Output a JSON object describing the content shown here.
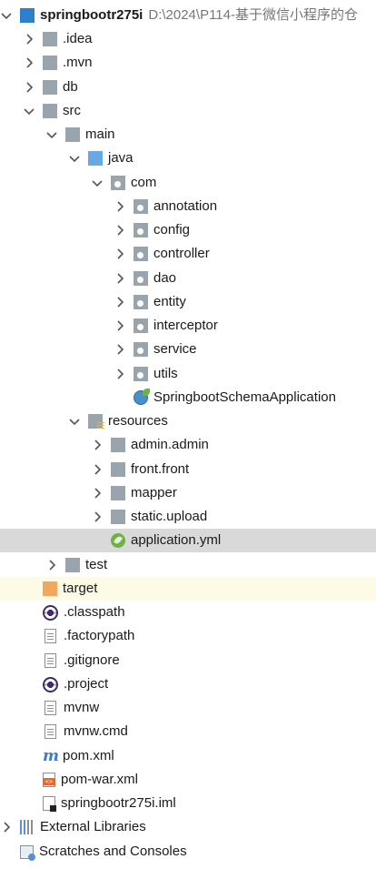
{
  "project": {
    "name": "springbootr275i",
    "path": "D:\\2024\\P114-基于微信小程序的仓"
  },
  "tree": {
    "idea": ".idea",
    "mvn": ".mvn",
    "db": "db",
    "src": "src",
    "main": "main",
    "java": "java",
    "com": "com",
    "annotation": "annotation",
    "config": "config",
    "controller": "controller",
    "dao": "dao",
    "entity": "entity",
    "interceptor": "interceptor",
    "service": "service",
    "utils": "utils",
    "app_class": "SpringbootSchemaApplication",
    "resources": "resources",
    "admin": "admin.admin",
    "front": "front.front",
    "mapper": "mapper",
    "static_upload": "static.upload",
    "application_yml": "application.yml",
    "test": "test",
    "target": "target",
    "classpath": ".classpath",
    "factorypath": ".factorypath",
    "gitignore": ".gitignore",
    "project_file": ".project",
    "mvnw": "mvnw",
    "mvnw_cmd": "mvnw.cmd",
    "pom": "pom.xml",
    "pom_war": "pom-war.xml",
    "iml": "springbootr275i.iml",
    "external_libraries": "External Libraries",
    "scratches": "Scratches and Consoles"
  },
  "icons": {
    "arrow_collapsed": "chevron-right-icon",
    "arrow_expanded": "chevron-down-icon"
  },
  "colors": {
    "selected_row": "#d9d9d9",
    "target_row": "#fdfbe5",
    "folder_gray": "#9aa4ad",
    "folder_blue": "#69a7e6",
    "folder_orange": "#f3a65e"
  }
}
